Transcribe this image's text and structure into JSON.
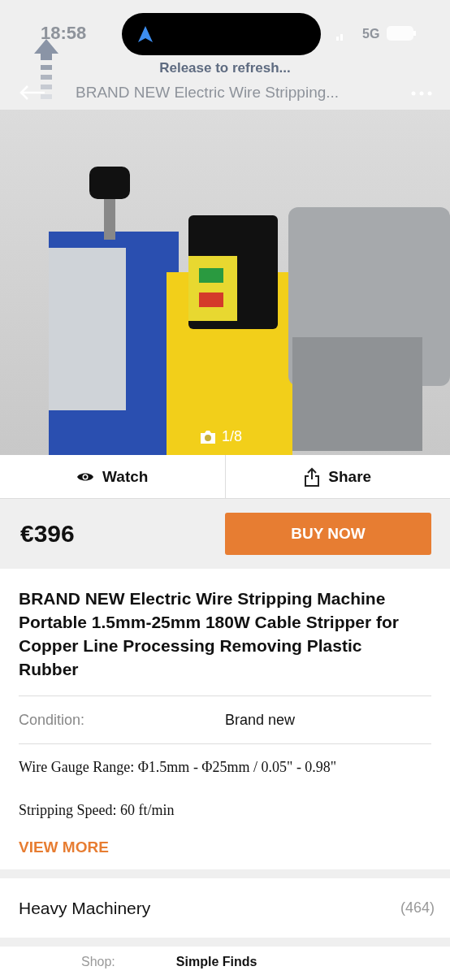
{
  "status_bar": {
    "time": "18:58",
    "network": "5G"
  },
  "refresh": {
    "text": "Release to refresh..."
  },
  "header": {
    "title": "BRAND NEW Electric Wire Stripping..."
  },
  "gallery": {
    "counter": "1/8"
  },
  "actions": [
    {
      "kind": "watch",
      "label": "Watch"
    },
    {
      "kind": "share",
      "label": "Share"
    }
  ],
  "price": "€396",
  "buy_button": "BUY NOW",
  "title": "BRAND NEW Electric Wire Stripping Machine Portable 1.5mm-25mm 180W Cable Stripper for Copper Line Processing Removing Plastic Rubber",
  "condition": {
    "label": "Condition:",
    "value": "Brand new"
  },
  "specs": [
    "Wire Gauge Range: Φ1.5mm - Φ25mm / 0.05\" - 0.98\"",
    "Stripping Speed: 60 ft/min"
  ],
  "view_more": "VIEW MORE",
  "category": {
    "name": "Heavy Machinery",
    "count": "(464)"
  },
  "shop": {
    "label": "Shop:",
    "value": "Simple Finds"
  }
}
